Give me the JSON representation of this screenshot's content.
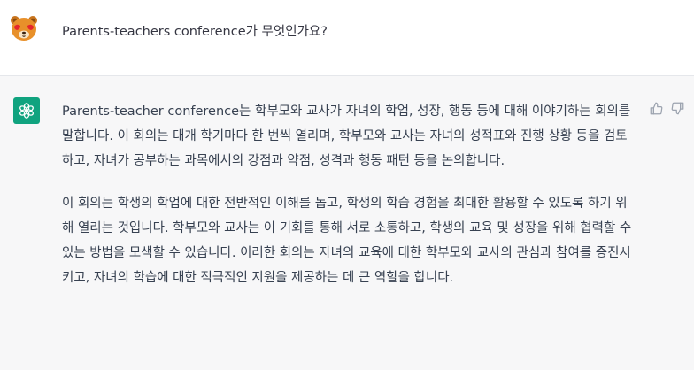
{
  "conversation": {
    "user_message": {
      "avatar": "bear-mascot-avatar-icon",
      "text": "Parents-teachers conference가 무엇인가요?"
    },
    "assistant_message": {
      "avatar": "assistant-logo-icon",
      "paragraphs": [
        "Parents-teacher conference는 학부모와 교사가 자녀의 학업, 성장, 행동 등에 대해 이야기하는 회의를 말합니다. 이 회의는 대개 학기마다 한 번씩 열리며, 학부모와 교사는 자녀의 성적표와 진행 상황 등을 검토하고, 자녀가 공부하는 과목에서의 강점과 약점, 성격과 행동 패턴 등을 논의합니다.",
        "이 회의는 학생의 학업에 대한 전반적인 이해를 돕고, 학생의 학습 경험을 최대한 활용할 수 있도록 하기 위해 열리는 것입니다. 학부모와 교사는 이 기회를 통해 서로 소통하고, 학생의 교육 및 성장을 위해 협력할 수 있는 방법을 모색할 수 있습니다. 이러한 회의는 자녀의 교육에 대한 학부모와 교사의 관심과 참여를 증진시키고, 자녀의 학습에 대한 적극적인 지원을 제공하는 데 큰 역할을 합니다."
      ],
      "actions": [
        "thumbs-up-icon",
        "thumbs-down-icon"
      ]
    }
  },
  "colors": {
    "assistant_background": "#f7f7f8",
    "assistant_avatar": "#10a37f",
    "text": "#374151"
  }
}
